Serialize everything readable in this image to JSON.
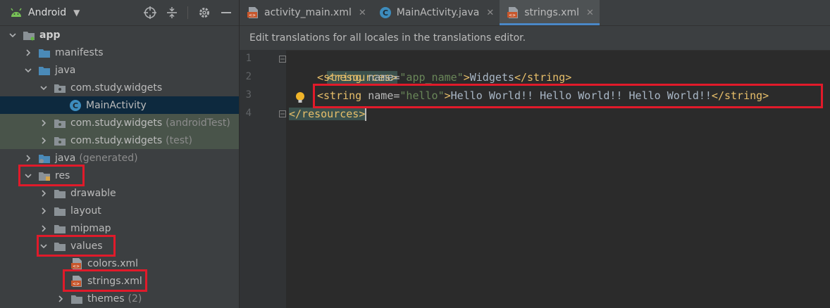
{
  "project_panel": {
    "view_name": "Android",
    "items": [
      {
        "label": "app",
        "suffix": ""
      },
      {
        "label": "manifests",
        "suffix": ""
      },
      {
        "label": "java",
        "suffix": ""
      },
      {
        "label": "com.study.widgets",
        "suffix": ""
      },
      {
        "label": "MainActivity",
        "suffix": ""
      },
      {
        "label": "com.study.widgets",
        "suffix": "(androidTest)"
      },
      {
        "label": "com.study.widgets",
        "suffix": "(test)"
      },
      {
        "label": "java",
        "suffix": "(generated)"
      },
      {
        "label": "res",
        "suffix": ""
      },
      {
        "label": "drawable",
        "suffix": ""
      },
      {
        "label": "layout",
        "suffix": ""
      },
      {
        "label": "mipmap",
        "suffix": ""
      },
      {
        "label": "values",
        "suffix": ""
      },
      {
        "label": "colors.xml",
        "suffix": ""
      },
      {
        "label": "strings.xml",
        "suffix": ""
      },
      {
        "label": "themes",
        "suffix": "(2)"
      }
    ]
  },
  "editor": {
    "tabs": [
      {
        "label": "activity_main.xml"
      },
      {
        "label": "MainActivity.java"
      },
      {
        "label": "strings.xml"
      }
    ],
    "notice": "Edit translations for all locales in the translations editor.",
    "line_numbers": [
      "1",
      "2",
      "3",
      "4"
    ],
    "code": {
      "l1_tag": "<resources>",
      "l2_open": "<string",
      "l2_attr": " name=",
      "l2_val": "\"app_name\"",
      "l2_gt": ">",
      "l2_text": "Widgets",
      "l2_close": "</string>",
      "l3_open": "<string",
      "l3_attr": " name=",
      "l3_val": "\"hello\"",
      "l3_gt": ">",
      "l3_text": "Hello World!! Hello World!! Hello World!!",
      "l3_close": "</string>",
      "l4_tag": "</resources>"
    }
  },
  "colors": {
    "highlight_box": "#e11a2a",
    "selection": "#0d293e",
    "tab_accent": "#4a88c7",
    "xml_tag": "#e8bf6a",
    "xml_value": "#6a8759"
  }
}
